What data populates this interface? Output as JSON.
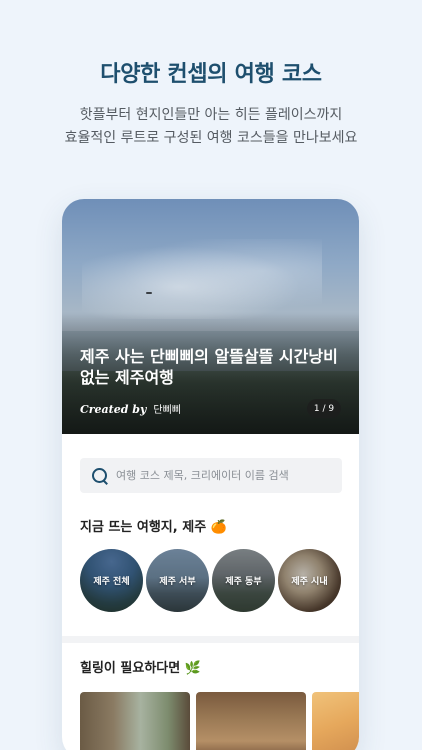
{
  "headline": "다양한 컨셉의 여행 코스",
  "subtitle_lines": [
    "핫플부터 현지인들만 아는 히든 플레이스까지",
    "효율적인 루트로 구성된 여행 코스들을 만나보세요"
  ],
  "hero": {
    "title_lines": [
      "제주 사는 단삐삐의 알뜰살뜰 시간낭비",
      "없는 제주여행"
    ],
    "created_by": "Created by",
    "creator": "단삐삐",
    "pager": "1 / 9"
  },
  "search": {
    "placeholder": "여행 코스 제목, 크리에이터 이름 검색",
    "value": ""
  },
  "trending": {
    "title": "지금 뜨는 여행지, 제주 🍊",
    "regions": [
      "제주 전체",
      "제주 서부",
      "제주 동부",
      "제주 시내"
    ]
  },
  "healing": {
    "title": "힐링이 필요하다면 🌿"
  },
  "colors": {
    "accent": "#1e4f6e",
    "background": "#eef4fb"
  }
}
